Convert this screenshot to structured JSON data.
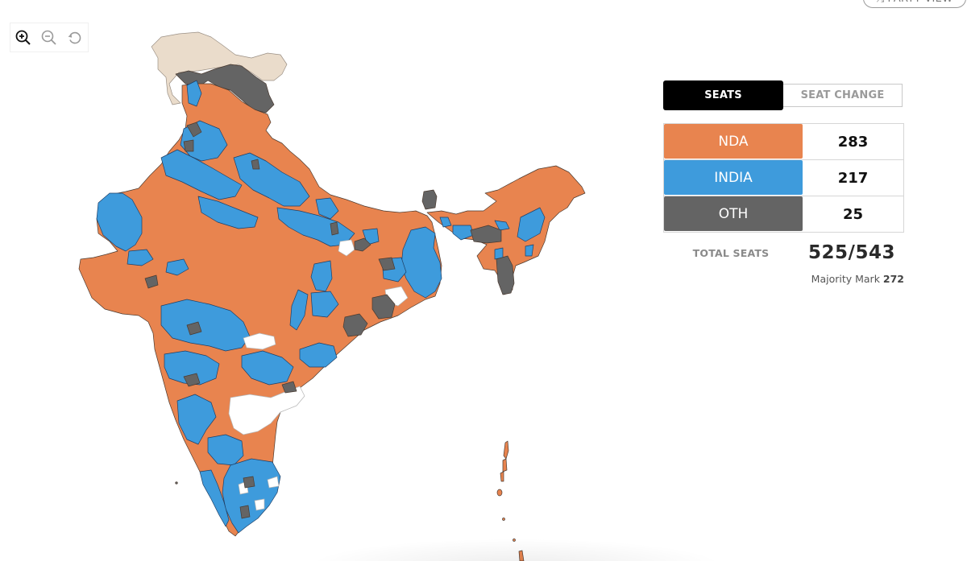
{
  "header": {
    "party_view_label": "PARTY VIEW",
    "party_view_icon": "shuffle-icon"
  },
  "zoom_controls": [
    {
      "name": "zoom-in",
      "icon": "zoom-in-icon",
      "enabled": true
    },
    {
      "name": "zoom-out",
      "icon": "zoom-out-icon",
      "enabled": false
    },
    {
      "name": "reset",
      "icon": "reset-icon",
      "enabled": false
    }
  ],
  "tabs": {
    "seats_label": "SEATS",
    "seat_change_label": "SEAT CHANGE",
    "active": "SEATS"
  },
  "alliances": [
    {
      "name": "NDA",
      "seats": "283",
      "color": "#E8844F"
    },
    {
      "name": "INDIA",
      "seats": "217",
      "color": "#3E9BDC"
    },
    {
      "name": "OTH",
      "seats": "25",
      "color": "#646464"
    }
  ],
  "totals": {
    "label": "TOTAL SEATS",
    "value": "525/543"
  },
  "majority": {
    "label": "Majority Mark",
    "value": "272"
  },
  "map": {
    "legend_colors": {
      "NDA": "#E8844F",
      "INDIA": "#3E9BDC",
      "OTH": "#646464",
      "undeclared": "#FFFFFF",
      "disputed": "#EADCCB"
    }
  }
}
